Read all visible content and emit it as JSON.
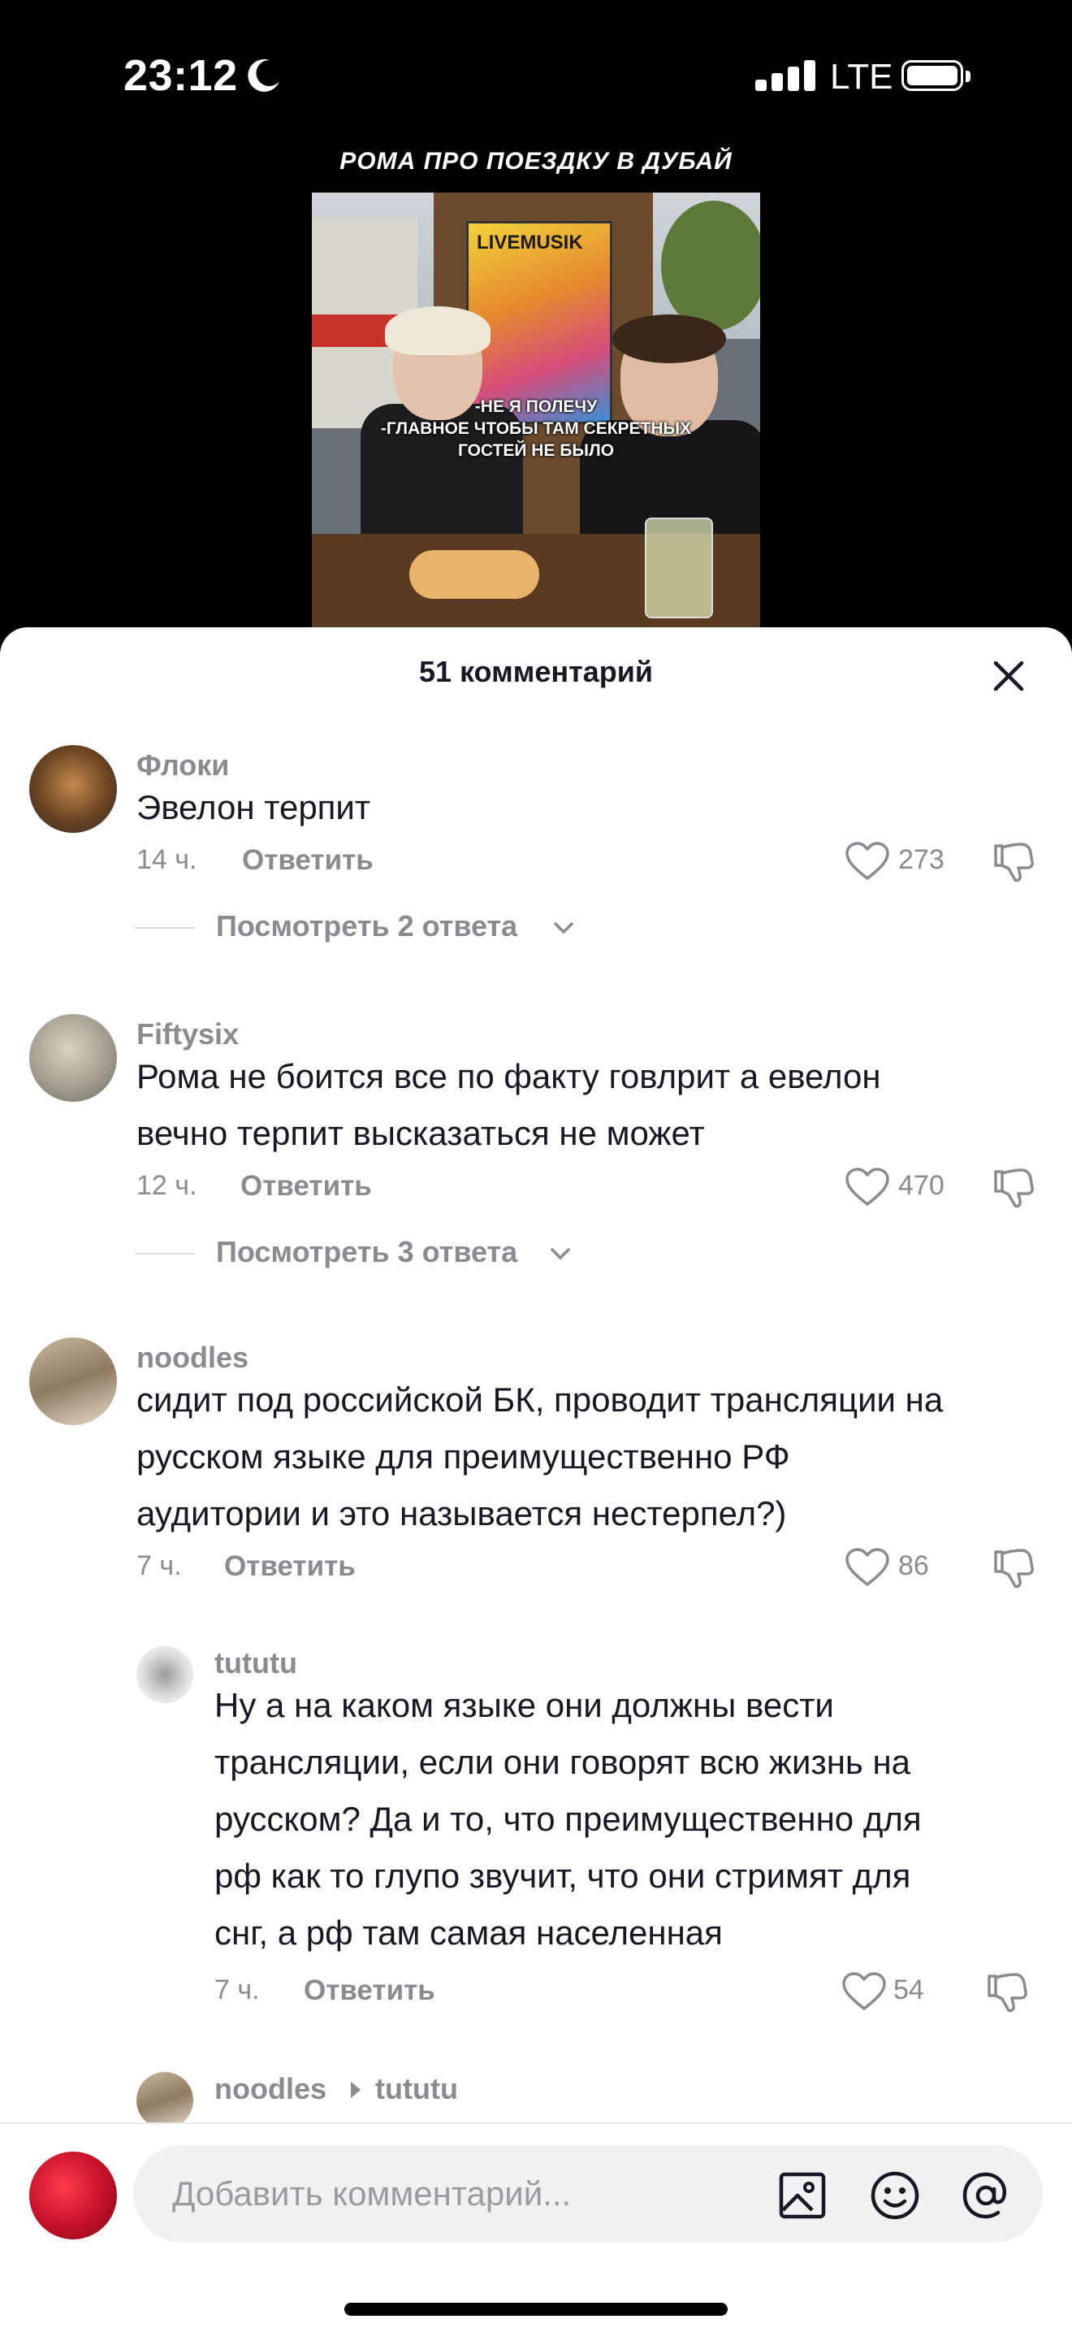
{
  "status_bar": {
    "time": "23:12",
    "network": "LTE"
  },
  "video": {
    "title": "РОМА ПРО ПОЕЗДКУ В ДУБАЙ",
    "poster_text": "LIVEMUSIK",
    "subtitle_lines": [
      "-НЕ Я ПОЛЕЧУ",
      "-ГЛАВНОЕ ЧТОБЫ ТАМ СЕКРЕТНЫХ",
      "ГОСТЕЙ НЕ БЫЛО"
    ]
  },
  "sheet": {
    "title": "51 комментарий"
  },
  "comments": [
    {
      "username": "Флоки",
      "text_lines": [
        "Эвелон терпит"
      ],
      "time": "14 ч.",
      "reply_label": "Ответить",
      "likes": "273",
      "view_replies": "Посмотреть 2 ответа"
    },
    {
      "username": "Fiftysix",
      "text_lines": [
        "Рома не боится все по факту говлрит а евелон",
        "вечно терпит высказаться не может"
      ],
      "time": "12 ч.",
      "reply_label": "Ответить",
      "likes": "470",
      "view_replies": "Посмотреть 3 ответа"
    },
    {
      "username": "noodles",
      "text_lines": [
        "сидит под российской БК, проводит трансляции на",
        "русском языке для преимущественно РФ",
        "аудитории и это называется нестерпел?)"
      ],
      "time": "7 ч.",
      "reply_label": "Ответить",
      "likes": "86"
    }
  ],
  "replies": [
    {
      "username": "tututu",
      "text_lines": [
        "Ну а на каком языке они должны вести",
        "трансляции, если они говорят всю жизнь на",
        "русском? Да и то, что преимущественно для",
        "рф как то глупо звучит, что они стримят для",
        "снг, а рф там самая населенная"
      ],
      "time": "7 ч.",
      "reply_label": "Ответить",
      "likes": "54"
    },
    {
      "username": "noodles",
      "reply_to": "tututu"
    }
  ],
  "input": {
    "placeholder": "Добавить комментарий..."
  },
  "colors": {
    "secondary_text": "#8a8b91",
    "primary_text": "#161823",
    "sheet_bg": "#ffffff"
  }
}
